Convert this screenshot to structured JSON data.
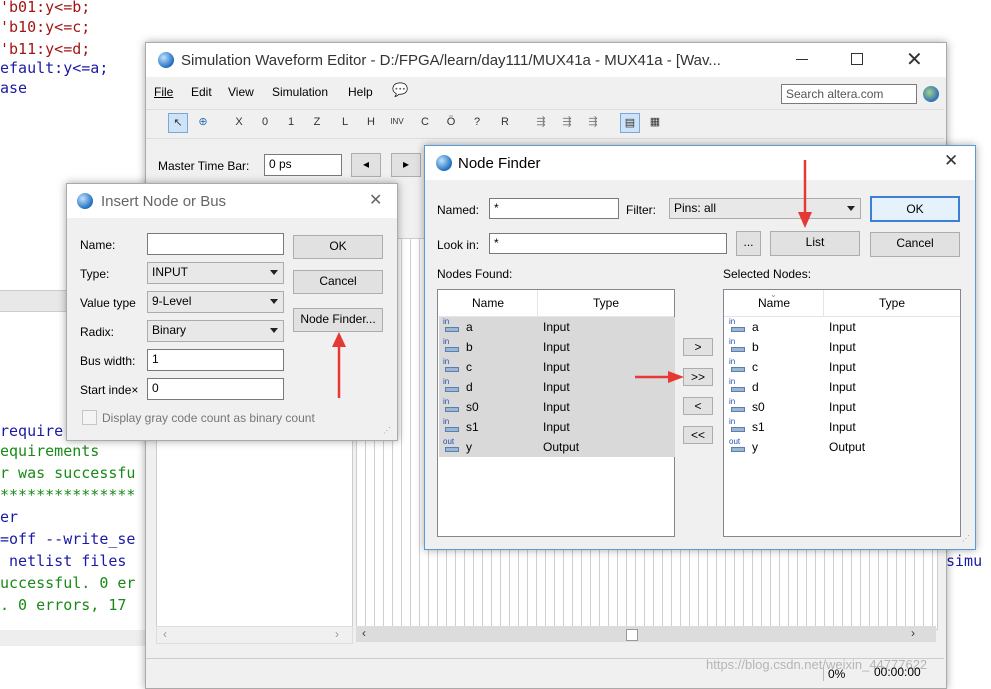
{
  "background": {
    "code_lines_top": [
      "'b01:y<=b;",
      "'b10:y<=c;",
      "'b11:y<=d;",
      "efault:y<=a;",
      "ase"
    ],
    "console_lines": [
      "require",
      "equirements",
      "r was successfu",
      "***************",
      "er",
      "=off --write_se",
      " netlist files",
      "uccessful. 0 er",
      ". 0 errors, 17"
    ],
    "right_edge_text": "simu"
  },
  "swe": {
    "title": "Simulation Waveform Editor - D:/FPGA/learn/day111/MUX41a - MUX41a - [Wav...",
    "menu": [
      "File",
      "Edit",
      "View",
      "Simulation",
      "Help"
    ],
    "search_placeholder": "Search altera.com",
    "master_time_bar_label": "Master Time Bar:",
    "master_time_value": "0 ps",
    "status_percent": "0%",
    "status_time": "00:00:00",
    "watermark": "https://blog.csdn.net/weixin_44777622",
    "colors": {
      "accent": "#3c7fd6",
      "red_arrow": "#e53935"
    }
  },
  "insert_node": {
    "title": "Insert Node or Bus",
    "name_label": "Name:",
    "name_value": "",
    "type_label": "Type:",
    "type_value": "INPUT",
    "value_type_label": "Value type",
    "value_type_value": "9-Level",
    "radix_label": "Radix:",
    "radix_value": "Binary",
    "bus_width_label": "Bus width:",
    "bus_width_value": "1",
    "start_index_label": "Start inde×",
    "start_index_value": "0",
    "gray_code_label": "Display gray code count as binary count",
    "ok_label": "OK",
    "cancel_label": "Cancel",
    "node_finder_label": "Node Finder..."
  },
  "node_finder": {
    "title": "Node Finder",
    "named_label": "Named:",
    "named_value": "*",
    "filter_label": "Filter:",
    "filter_value": "Pins: all",
    "look_in_label": "Look in:",
    "look_in_value": "*",
    "browse_label": "...",
    "list_label": "List",
    "ok_label": "OK",
    "cancel_label": "Cancel",
    "nodes_found_label": "Nodes Found:",
    "selected_nodes_label": "Selected Nodes:",
    "col_name": "Name",
    "col_type": "Type",
    "move_one_right": ">",
    "move_all_right": ">>",
    "move_one_left": "<",
    "move_all_left": "<<",
    "nodes_found": [
      {
        "dir": "in",
        "name": "a",
        "type": "Input"
      },
      {
        "dir": "in",
        "name": "b",
        "type": "Input"
      },
      {
        "dir": "in",
        "name": "c",
        "type": "Input"
      },
      {
        "dir": "in",
        "name": "d",
        "type": "Input"
      },
      {
        "dir": "in",
        "name": "s0",
        "type": "Input"
      },
      {
        "dir": "in",
        "name": "s1",
        "type": "Input"
      },
      {
        "dir": "out",
        "name": "y",
        "type": "Output"
      }
    ],
    "selected_nodes": [
      {
        "dir": "in",
        "name": "a",
        "type": "Input"
      },
      {
        "dir": "in",
        "name": "b",
        "type": "Input"
      },
      {
        "dir": "in",
        "name": "c",
        "type": "Input"
      },
      {
        "dir": "in",
        "name": "d",
        "type": "Input"
      },
      {
        "dir": "in",
        "name": "s0",
        "type": "Input"
      },
      {
        "dir": "in",
        "name": "s1",
        "type": "Input"
      },
      {
        "dir": "out",
        "name": "y",
        "type": "Output"
      }
    ]
  }
}
